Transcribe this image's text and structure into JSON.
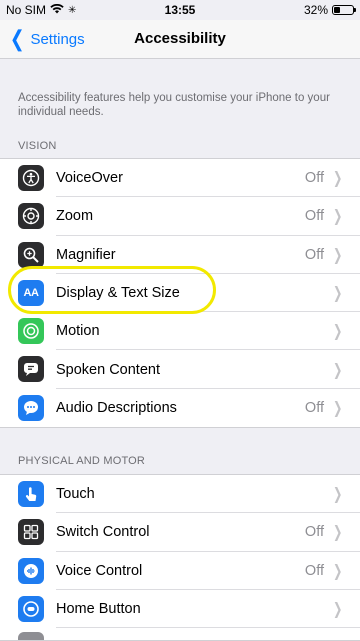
{
  "status_bar": {
    "carrier": "No SIM",
    "time": "13:55",
    "battery_percent": "32%",
    "battery_level": 0.32
  },
  "nav": {
    "back_label": "Settings",
    "title": "Accessibility"
  },
  "intro_text": "Accessibility features help you customise your iPhone to your individual needs.",
  "sections": [
    {
      "header": "VISION",
      "rows": [
        {
          "label": "VoiceOver",
          "value": "Off",
          "icon": "voiceover-icon",
          "icon_color": "#2c2c2e"
        },
        {
          "label": "Zoom",
          "value": "Off",
          "icon": "zoom-icon",
          "icon_color": "#2c2c2e"
        },
        {
          "label": "Magnifier",
          "value": "Off",
          "icon": "magnifier-icon",
          "icon_color": "#2c2c2e"
        },
        {
          "label": "Display & Text Size",
          "value": "",
          "icon": "display-text-size-icon",
          "icon_color": "#1e7cf0"
        },
        {
          "label": "Motion",
          "value": "",
          "icon": "motion-icon",
          "icon_color": "#34c759"
        },
        {
          "label": "Spoken Content",
          "value": "",
          "icon": "spoken-content-icon",
          "icon_color": "#2c2c2e"
        },
        {
          "label": "Audio Descriptions",
          "value": "Off",
          "icon": "audio-descriptions-icon",
          "icon_color": "#1e7cf0"
        }
      ]
    },
    {
      "header": "PHYSICAL AND MOTOR",
      "rows": [
        {
          "label": "Touch",
          "value": "",
          "icon": "touch-icon",
          "icon_color": "#1e7cf0"
        },
        {
          "label": "Switch Control",
          "value": "Off",
          "icon": "switch-control-icon",
          "icon_color": "#2c2c2e"
        },
        {
          "label": "Voice Control",
          "value": "Off",
          "icon": "voice-control-icon",
          "icon_color": "#1e7cf0"
        },
        {
          "label": "Home Button",
          "value": "",
          "icon": "home-button-icon",
          "icon_color": "#1e7cf0"
        }
      ]
    }
  ],
  "colors": {
    "accent": "#0a7aff",
    "highlight": "#f2e900",
    "background": "#efeff4"
  }
}
